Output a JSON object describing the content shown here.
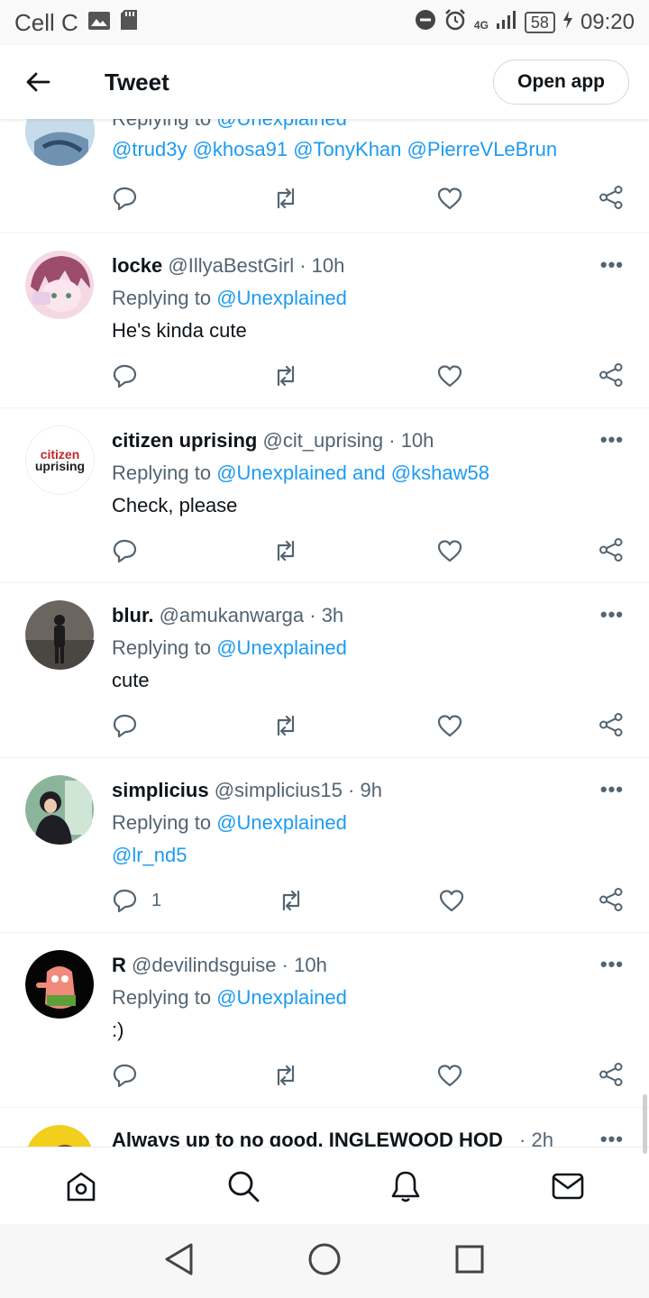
{
  "status_bar": {
    "carrier": "Cell C",
    "network": "4G",
    "battery": "58",
    "time": "09:20"
  },
  "header": {
    "title": "Tweet",
    "open_app_label": "Open app"
  },
  "partial_tweet": {
    "replying_prefix": "Replying to",
    "replying_handle": "@Unexplained",
    "mentions": "@trud3y @khosa91 @TonyKhan  @PierreVLeBrun"
  },
  "tweets": [
    {
      "name": "locke",
      "handle": "@IllyaBestGirl",
      "time": "10h",
      "replying_prefix": "Replying to",
      "replying_to": "@Unexplained",
      "text": "He's kinda cute",
      "reply_count": ""
    },
    {
      "name": "citizen uprising",
      "handle": "@cit_uprising",
      "time": "10h",
      "replying_prefix": "Replying to",
      "replying_to": "@Unexplained and @kshaw58",
      "text": "Check, please",
      "reply_count": "",
      "avatar_text_1": "citizen",
      "avatar_text_2": "uprising"
    },
    {
      "name": "blur.",
      "handle": "@amukanwarga",
      "time": "3h",
      "replying_prefix": "Replying to",
      "replying_to": "@Unexplained",
      "text": "cute",
      "reply_count": ""
    },
    {
      "name": "simplicius",
      "handle": "@simplicius15",
      "time": "9h",
      "replying_prefix": "Replying to",
      "replying_to": "@Unexplained",
      "text": "@lr_nd5",
      "reply_count": "1"
    },
    {
      "name": "R",
      "handle": "@devilindsguise",
      "time": "10h",
      "replying_prefix": "Replying to",
      "replying_to": "@Unexplained",
      "text": ":)",
      "reply_count": ""
    }
  ],
  "last_tweet": {
    "name": "Always up to no good, INGLEWOOD HOD",
    "time": "2h"
  },
  "dot_sep": "·",
  "more_label": "•••",
  "tabbar": [
    "home-icon",
    "search-icon",
    "notifications-icon",
    "messages-icon"
  ],
  "navbar": [
    "back-triangle",
    "home-circle",
    "recents-square"
  ],
  "colors": {
    "link": "#1d9bf0",
    "text": "#0f1419",
    "muted": "#536471",
    "divider": "#eff3f4"
  }
}
